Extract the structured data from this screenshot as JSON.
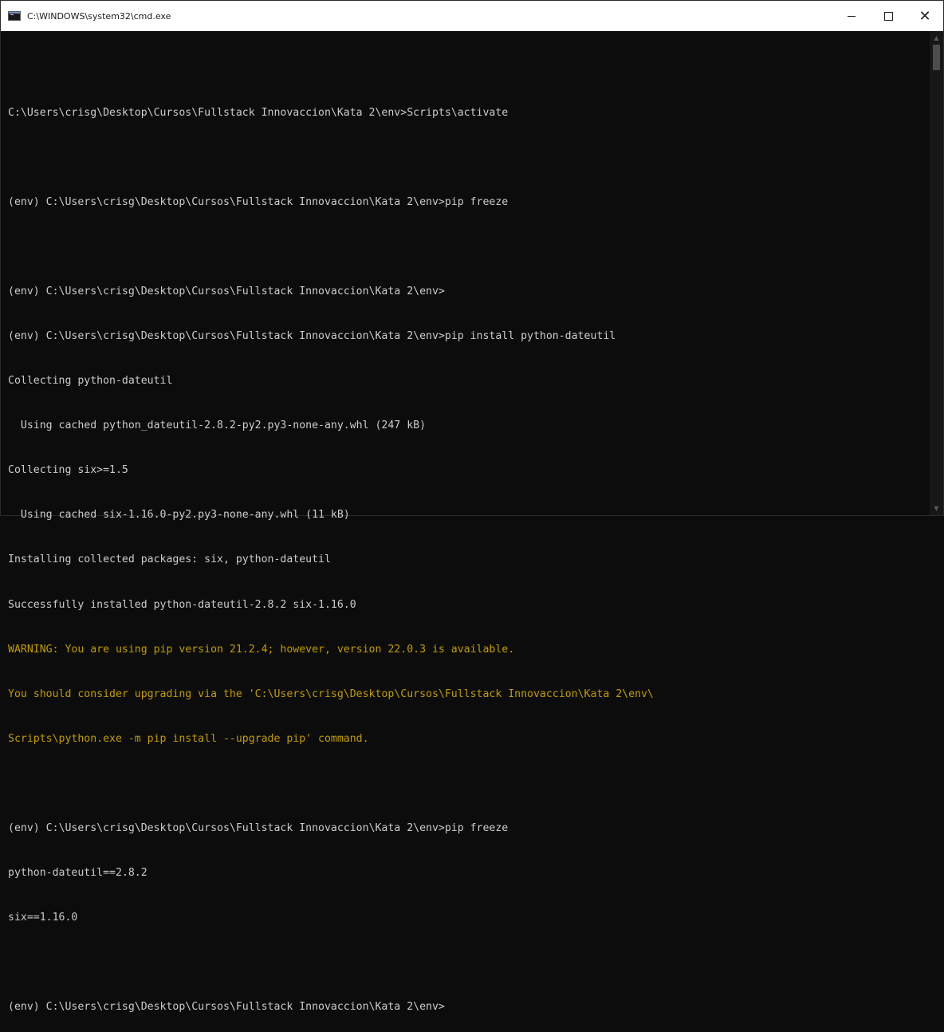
{
  "window": {
    "title": "C:\\WINDOWS\\system32\\cmd.exe",
    "minimize_label": "–",
    "close_label": "✕"
  },
  "colors": {
    "background": "#0c0c0c",
    "text": "#cccccc",
    "warning": "#c19c00"
  },
  "console": {
    "lines": [
      "",
      "C:\\Users\\crisg\\Desktop\\Cursos\\Fullstack Innovaccion\\Kata 2\\env>Scripts\\activate",
      "",
      "(env) C:\\Users\\crisg\\Desktop\\Cursos\\Fullstack Innovaccion\\Kata 2\\env>pip freeze",
      "",
      "(env) C:\\Users\\crisg\\Desktop\\Cursos\\Fullstack Innovaccion\\Kata 2\\env>",
      "(env) C:\\Users\\crisg\\Desktop\\Cursos\\Fullstack Innovaccion\\Kata 2\\env>pip install python-dateutil",
      "Collecting python-dateutil",
      "  Using cached python_dateutil-2.8.2-py2.py3-none-any.whl (247 kB)",
      "Collecting six>=1.5",
      "  Using cached six-1.16.0-py2.py3-none-any.whl (11 kB)",
      "Installing collected packages: six, python-dateutil",
      "Successfully installed python-dateutil-2.8.2 six-1.16.0",
      "WARNING: You are using pip version 21.2.4; however, version 22.0.3 is available.",
      "You should consider upgrading via the 'C:\\Users\\crisg\\Desktop\\Cursos\\Fullstack Innovaccion\\Kata 2\\env\\",
      "Scripts\\python.exe -m pip install --upgrade pip' command.",
      "",
      "(env) C:\\Users\\crisg\\Desktop\\Cursos\\Fullstack Innovaccion\\Kata 2\\env>pip freeze",
      "python-dateutil==2.8.2",
      "six==1.16.0",
      "",
      "(env) C:\\Users\\crisg\\Desktop\\Cursos\\Fullstack Innovaccion\\Kata 2\\env>"
    ]
  }
}
